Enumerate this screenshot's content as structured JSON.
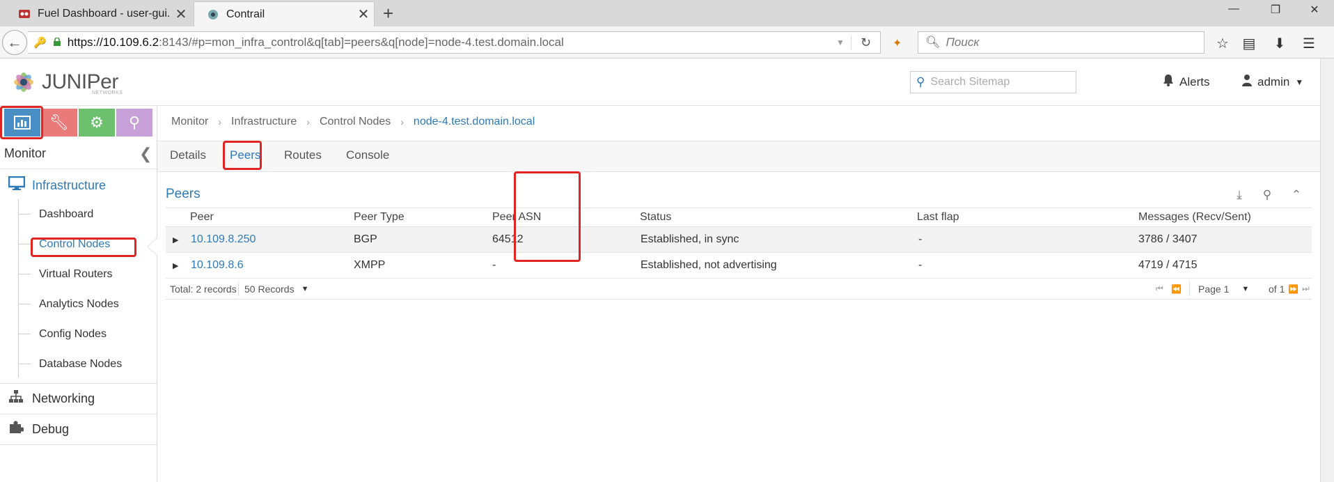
{
  "browser": {
    "tabs": [
      {
        "title": "Fuel Dashboard - user-gui..."
      },
      {
        "title": "Contrail"
      }
    ],
    "url": {
      "host": "https://10.109.6.2",
      "rest": ":8143/#p=mon_infra_control&q[tab]=peers&q[node]=node-4.test.domain.local"
    },
    "search_placeholder": "Поиск"
  },
  "header": {
    "logo_text": "JUNIPer",
    "logo_sub": "NETWORKS",
    "sitemap_placeholder": "Search Sitemap",
    "alerts_label": "Alerts",
    "user_label": "admin"
  },
  "sidebar": {
    "title": "Monitor",
    "sections": [
      {
        "label": "Infrastructure",
        "icon": "monitor-icon"
      },
      {
        "label": "Networking",
        "icon": "network-icon"
      },
      {
        "label": "Debug",
        "icon": "puzzle-icon"
      }
    ],
    "infra_items": [
      {
        "label": "Dashboard"
      },
      {
        "label": "Control Nodes",
        "active": true
      },
      {
        "label": "Virtual Routers"
      },
      {
        "label": "Analytics Nodes"
      },
      {
        "label": "Config Nodes"
      },
      {
        "label": "Database Nodes"
      }
    ]
  },
  "breadcrumb": [
    "Monitor",
    "Infrastructure",
    "Control Nodes",
    "node-4.test.domain.local"
  ],
  "page_tabs": [
    "Details",
    "Peers",
    "Routes",
    "Console"
  ],
  "active_tab": "Peers",
  "peers": {
    "title": "Peers",
    "columns": [
      "Peer",
      "Peer Type",
      "Peer ASN",
      "Status",
      "Last flap",
      "Messages (Recv/Sent)"
    ],
    "rows": [
      {
        "peer": "10.109.8.250",
        "type": "BGP",
        "asn": "64512",
        "status": "Established, in sync",
        "last_flap": "-",
        "messages": "3786 / 3407"
      },
      {
        "peer": "10.109.8.6",
        "type": "XMPP",
        "asn": "-",
        "status": "Established, not advertising",
        "last_flap": "-",
        "messages": "4719 / 4715"
      }
    ],
    "total": "Total: 2 records",
    "page_size": "50 Records",
    "page": "Page 1",
    "of_pages": "of 1"
  },
  "colors": {
    "accent": "#2e7ab8",
    "highlight": "#e02424",
    "monitor": "#4a8ec6",
    "configure": "#e87a7a",
    "setting": "#6cc06e",
    "query": "#c8a0d8"
  }
}
